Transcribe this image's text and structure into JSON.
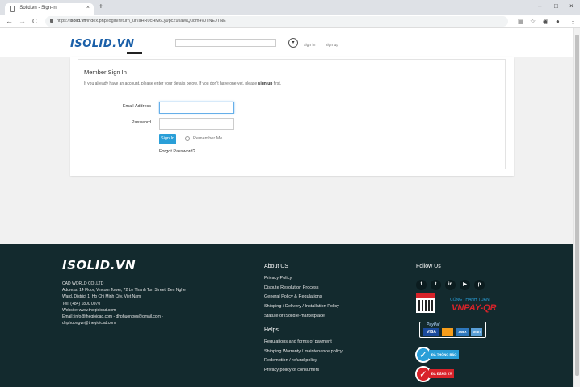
{
  "browser": {
    "tab_title": "iSolid.vn - Sign-in",
    "tab_close": "×",
    "new_tab": "+",
    "win_min": "–",
    "win_max": "□",
    "win_close": "×",
    "back": "←",
    "forward": "→",
    "reload": "C",
    "url_prefix": "https://",
    "url_host": "isolid.vn",
    "url_path": "/index.php/login/return_url/aHR0cHM6Ly9pc29saWQudm4vJTNEJTNE"
  },
  "header": {
    "logo": "ISOLID.VN",
    "sign_in": "sign in",
    "sign_up": "sign up"
  },
  "signin": {
    "title": "Member Sign In",
    "desc_part1": "If you already have an account, please enter your details below. If you don't have one yet, please",
    "desc_link": "sign up",
    "desc_part2": "first.",
    "email_label": "Email Address",
    "password_label": "Password",
    "button": "Sign In",
    "remember": "Remember Me",
    "forgot": "Forgot Password?"
  },
  "footer": {
    "logo": "ISOLID.VN",
    "company": "CAD WORLD CO.,LTD",
    "address1": "Address: 14 Floor, Vincom Tower, 72 Le Thanh Ton Street, Ben Nghe",
    "address2": "Ward, District 1, Ho Chi Minh City, Viet Nam",
    "tel": "Tell: (+84) 1800 0070",
    "website": "Website: www.thegioicad.com",
    "email1": "Email: info@thegioicad.com - dhphuongvn@gmail.com -",
    "email2": "dhphuongvn@thegioicad.com",
    "about": {
      "title": "About US",
      "links": [
        "Privacy Policy",
        "Dispute Resolution Process",
        "General Policy & Regulations",
        "Shipping / Delivery / Installation Policy",
        "Statute of iSolid e-marketplace"
      ]
    },
    "helps": {
      "title": "Helps",
      "links": [
        "Regulations and forms of payment",
        "Shipping Warranty / maintenance policy",
        "Redemption / refund policy",
        "Privacy policy of consumers"
      ]
    },
    "follow": {
      "title": "Follow Us",
      "icons": [
        "f",
        "t",
        "in",
        "▶",
        "p"
      ]
    },
    "payment": {
      "vnpay_top": "CỔNG THANH TOÁN",
      "vnpay": "VNPAY-QR",
      "paypal": "PayPal",
      "visa": "VISA",
      "amex": "AMEX",
      "debit": "DEBIT",
      "bct_notified": "ĐÃ THÔNG BÁO",
      "bct_registered": "ĐÃ ĐĂNG KÝ",
      "check": "✓"
    }
  }
}
